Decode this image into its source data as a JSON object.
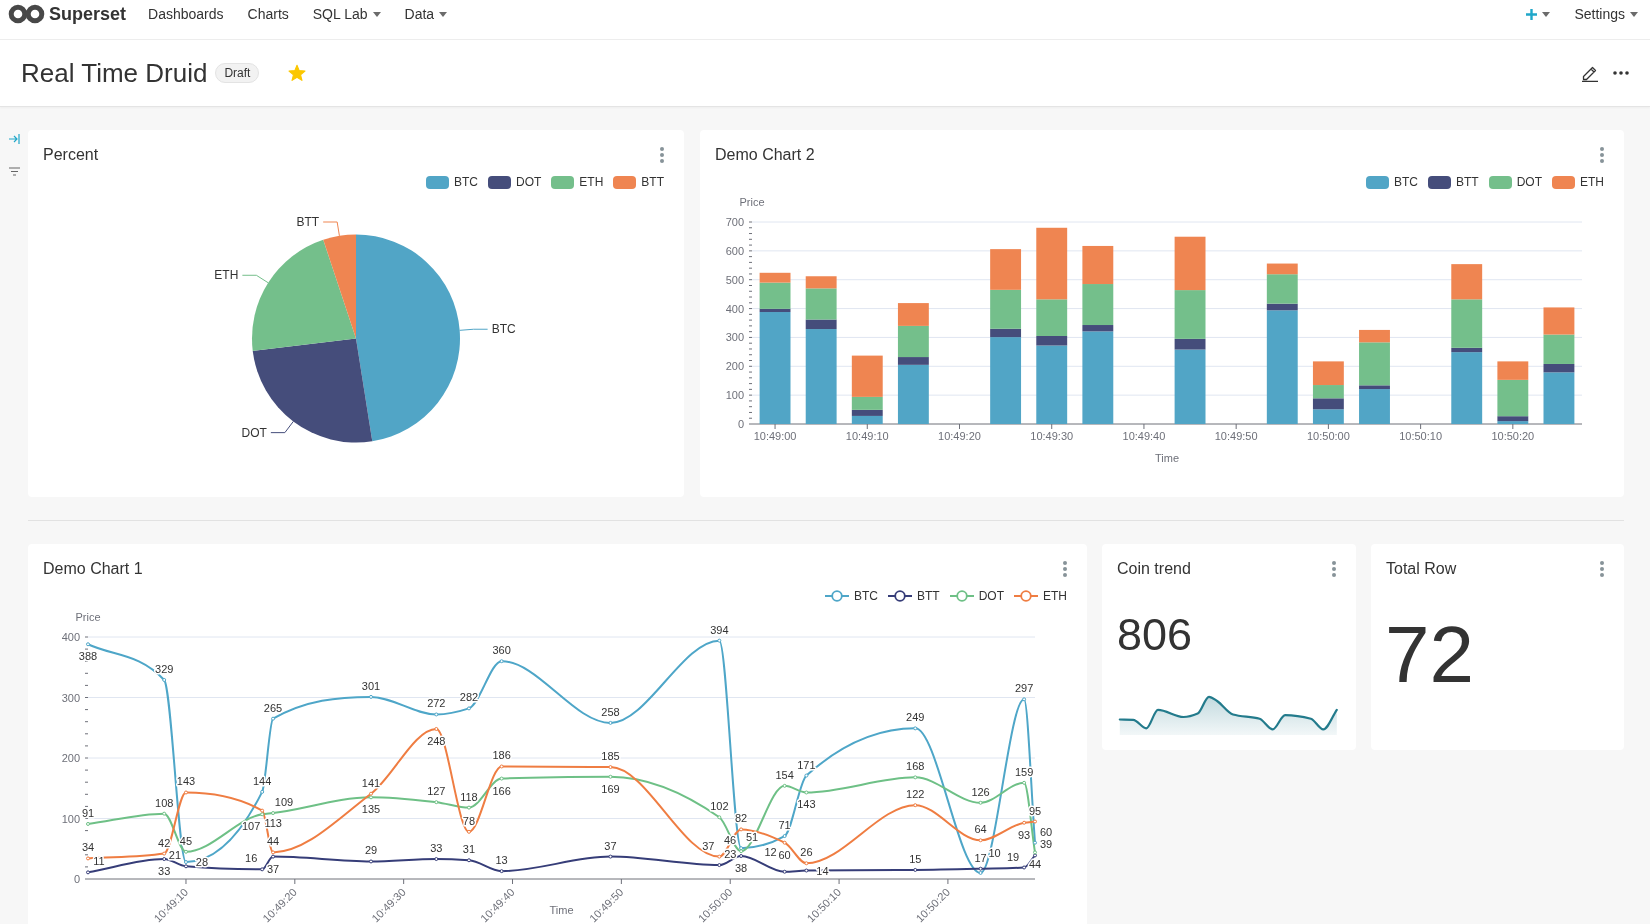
{
  "navbar": {
    "brand": "Superset",
    "menu": [
      {
        "label": "Dashboards",
        "dropdown": false
      },
      {
        "label": "Charts",
        "dropdown": false
      },
      {
        "label": "SQL Lab",
        "dropdown": true
      },
      {
        "label": "Data",
        "dropdown": true
      }
    ],
    "right_menu": [
      {
        "kind": "add",
        "dropdown": true
      },
      {
        "kind": "text",
        "label": "Settings",
        "dropdown": true
      }
    ]
  },
  "dashboard": {
    "title": "Real Time Druid",
    "status": "Draft",
    "favorite": true
  },
  "rows": [
    {
      "charts": [
        {
          "kind": "chart",
          "title": "Percent",
          "legend": [
            "BTC",
            "DOT",
            "ETH",
            "BTT"
          ],
          "chart_data": {
            "type": "pie",
            "categories": [
              "BTC",
              "DOT",
              "ETH",
              "BTT"
            ],
            "values": [
              47.5,
              25.6,
              21.8,
              5.1
            ]
          }
        },
        {
          "kind": "chart",
          "title": "Demo Chart 2",
          "chart_data": {
            "type": "bar",
            "stacked": true,
            "grid": true,
            "xlabel": "Time",
            "ylabel": "Price",
            "categories": [
              "10:49:00",
              null,
              "10:49:10",
              null,
              "10:49:20",
              null,
              "10:49:30",
              null,
              "10:49:40",
              null,
              "10:49:50",
              null,
              "10:50:00",
              null,
              "10:50:10",
              null,
              "10:50:20",
              null
            ],
            "ylim": [
              0,
              700
            ],
            "yticks": [
              0,
              100,
              200,
              300,
              400,
              500,
              600,
              700
            ],
            "series": [
              {
                "name": "BTC",
                "color": "#51a5c6",
                "values": [
                  388,
                  329,
                  28,
                  205,
                  null,
                  301,
                  272,
                  321,
                  null,
                  258,
                  null,
                  394,
                  51,
                  121,
                  null,
                  249,
                  10,
                  179
                ]
              },
              {
                "name": "BTT",
                "color": "#454d7b",
                "values": [
                  11,
                  33,
                  21,
                  27,
                  null,
                  29,
                  33,
                  22,
                  null,
                  37,
                  null,
                  23,
                  38,
                  13,
                  null,
                  15,
                  17,
                  29
                ]
              },
              {
                "name": "DOT",
                "color": "#74bf8b",
                "values": [
                  91,
                  108,
                  45,
                  108,
                  null,
                  135,
                  127,
                  142,
                  null,
                  169,
                  null,
                  102,
                  46,
                  149,
                  null,
                  168,
                  126,
                  102
                ]
              },
              {
                "name": "ETH",
                "color": "#ef8551",
                "values": [
                  34,
                  42,
                  143,
                  79,
                  null,
                  141,
                  248,
                  132,
                  null,
                  185,
                  null,
                  37,
                  82,
                  43,
                  null,
                  122,
                  64,
                  94
                ]
              }
            ]
          }
        }
      ]
    },
    {
      "charts": [
        {
          "kind": "chart",
          "title": "Demo Chart 1",
          "chart_data": {
            "type": "line",
            "grid": true,
            "xlabel": "Time",
            "ylabel": "Price",
            "data_labels": true,
            "categories": [
              null,
              null,
              null,
              null,
              null,
              null,
              null,
              null,
              null,
              "10:49:10",
              null,
              null,
              null,
              null,
              null,
              null,
              null,
              null,
              null,
              "10:49:20",
              null,
              null,
              null,
              null,
              null,
              null,
              null,
              null,
              null,
              "10:49:30",
              null,
              null,
              null,
              null,
              null,
              null,
              null,
              null,
              null,
              "10:49:40",
              null,
              null,
              null,
              null,
              null,
              null,
              null,
              null,
              null,
              "10:49:50",
              null,
              null,
              null,
              null,
              null,
              null,
              null,
              null,
              null,
              "10:50:00",
              null,
              null,
              null,
              null,
              null,
              null,
              null,
              null,
              null,
              "10:50:10",
              null,
              null,
              null,
              null,
              null,
              null,
              null,
              null,
              null,
              "10:50:20",
              null,
              null,
              null,
              null,
              null,
              null,
              null,
              null
            ],
            "ylim": [
              0,
              400
            ],
            "yticks": [
              0,
              100,
              200,
              300,
              400
            ],
            "series": [
              {
                "name": "BTC",
                "color": "#4ea6c8",
                "marker": "circle",
                "values": [
                  388,
                  null,
                  null,
                  null,
                  null,
                  null,
                  null,
                  329,
                  null,
                  28,
                  null,
                  null,
                  null,
                  null,
                  null,
                  null,
                  144,
                  265,
                  null,
                  null,
                  null,
                  null,
                  null,
                  null,
                  null,
                  null,
                  301,
                  null,
                  null,
                  null,
                  null,
                  null,
                  272,
                  null,
                  null,
                  282,
                  null,
                  null,
                  360,
                  null,
                  null,
                  null,
                  null,
                  null,
                  null,
                  null,
                  null,
                  null,
                  258,
                  null,
                  null,
                  null,
                  null,
                  null,
                  null,
                  null,
                  null,
                  null,
                  394,
                  null,
                  51,
                  null,
                  null,
                  null,
                  71,
                  null,
                  171,
                  null,
                  null,
                  null,
                  null,
                  null,
                  null,
                  null,
                  null,
                  null,
                  249,
                  null,
                  null,
                  null,
                  null,
                  null,
                  10,
                  null,
                  null,
                  null,
                  297,
                  60
                ]
              },
              {
                "name": "BTT",
                "color": "#363d78",
                "marker": "circle",
                "values": [
                  11,
                  null,
                  null,
                  null,
                  null,
                  null,
                  null,
                  33,
                  null,
                  21,
                  null,
                  null,
                  null,
                  null,
                  null,
                  null,
                  16,
                  37,
                  null,
                  null,
                  null,
                  null,
                  null,
                  null,
                  null,
                  null,
                  29,
                  null,
                  null,
                  null,
                  null,
                  null,
                  33,
                  null,
                  null,
                  31,
                  null,
                  null,
                  13,
                  null,
                  null,
                  null,
                  null,
                  null,
                  null,
                  null,
                  null,
                  null,
                  37,
                  null,
                  null,
                  null,
                  null,
                  null,
                  null,
                  null,
                  null,
                  null,
                  23,
                  null,
                  38,
                  null,
                  null,
                  null,
                  12,
                  null,
                  14,
                  null,
                  null,
                  null,
                  null,
                  null,
                  null,
                  null,
                  null,
                  null,
                  15,
                  null,
                  null,
                  null,
                  null,
                  null,
                  17,
                  null,
                  null,
                  null,
                  19,
                  39
                ]
              },
              {
                "name": "DOT",
                "color": "#6ec086",
                "marker": "circle",
                "values": [
                  91,
                  null,
                  null,
                  null,
                  null,
                  null,
                  null,
                  108,
                  null,
                  45,
                  null,
                  null,
                  null,
                  null,
                  null,
                  null,
                  107,
                  109,
                  null,
                  null,
                  null,
                  null,
                  null,
                  null,
                  null,
                  null,
                  135,
                  null,
                  null,
                  null,
                  null,
                  null,
                  127,
                  null,
                  null,
                  118,
                  null,
                  null,
                  166,
                  null,
                  null,
                  null,
                  null,
                  null,
                  null,
                  null,
                  null,
                  null,
                  169,
                  null,
                  null,
                  null,
                  null,
                  null,
                  null,
                  null,
                  null,
                  null,
                  102,
                  null,
                  46,
                  null,
                  null,
                  null,
                  154,
                  null,
                  143,
                  null,
                  null,
                  null,
                  null,
                  null,
                  null,
                  null,
                  null,
                  null,
                  168,
                  null,
                  null,
                  null,
                  null,
                  null,
                  126,
                  null,
                  null,
                  null,
                  159,
                  44
                ]
              },
              {
                "name": "ETH",
                "color": "#ef7d42",
                "marker": "circle",
                "values": [
                  34,
                  null,
                  null,
                  null,
                  null,
                  null,
                  null,
                  42,
                  null,
                  143,
                  null,
                  null,
                  null,
                  null,
                  null,
                  null,
                  113,
                  44,
                  null,
                  null,
                  null,
                  null,
                  null,
                  null,
                  null,
                  null,
                  141,
                  null,
                  null,
                  null,
                  null,
                  null,
                  248,
                  null,
                  null,
                  78,
                  null,
                  null,
                  186,
                  null,
                  null,
                  null,
                  null,
                  null,
                  null,
                  null,
                  null,
                  null,
                  185,
                  null,
                  null,
                  null,
                  null,
                  null,
                  null,
                  null,
                  null,
                  null,
                  37,
                  null,
                  82,
                  null,
                  null,
                  null,
                  60,
                  null,
                  26,
                  null,
                  null,
                  null,
                  null,
                  null,
                  null,
                  null,
                  null,
                  null,
                  122,
                  null,
                  null,
                  null,
                  null,
                  null,
                  64,
                  null,
                  null,
                  null,
                  93,
                  95
                ]
              }
            ]
          }
        },
        {
          "kind": "big_number_trendline",
          "title": "Coin trend",
          "value": "806"
        },
        {
          "kind": "big_number",
          "title": "Total Row",
          "value": "72"
        }
      ]
    }
  ]
}
